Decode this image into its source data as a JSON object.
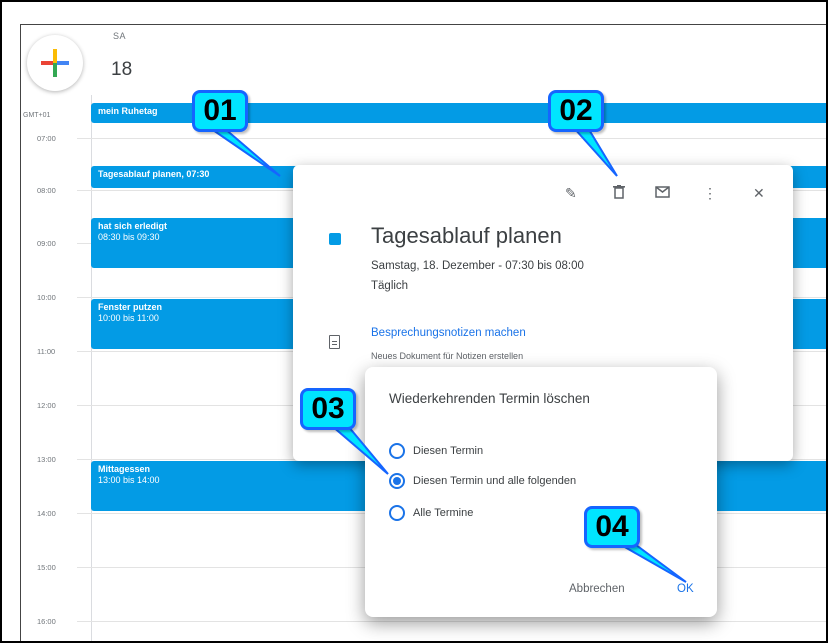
{
  "header": {
    "day_name": "SA",
    "day_number": "18",
    "timezone": "GMT+01"
  },
  "times": [
    "07:00",
    "08:00",
    "09:00",
    "10:00",
    "11:00",
    "12:00",
    "13:00",
    "14:00",
    "15:00",
    "16:00"
  ],
  "events": {
    "allday": "mein Ruhetag",
    "e1": {
      "title": "Tagesablauf planen, 07:30"
    },
    "e2": {
      "title": "hat sich erledigt",
      "time": "08:30 bis 09:30"
    },
    "e3": {
      "title": "Fenster putzen",
      "time": "10:00 bis 11:00"
    },
    "e4": {
      "title": "Mittagessen",
      "time": "13:00 bis 14:00"
    }
  },
  "popup": {
    "title": "Tagesablauf planen",
    "when": "Samstag, 18. Dezember  -  07:30 bis 08:00",
    "recurrence": "Täglich",
    "notes_link": "Besprechungsnotizen machen",
    "notes_sub": "Neues Dokument für Notizen erstellen",
    "icons": [
      "pencil-icon",
      "trash-icon",
      "mail-icon",
      "more-vert-icon",
      "close-icon"
    ]
  },
  "dialog": {
    "title": "Wiederkehrenden Termin löschen",
    "options": [
      "Diesen Termin",
      "Diesen Termin und alle folgenden",
      "Alle Termine"
    ],
    "selected_index": 1,
    "cancel": "Abbrechen",
    "ok": "OK"
  },
  "callouts": [
    "01",
    "02",
    "03",
    "04"
  ],
  "colors": {
    "event": "#039be5",
    "accent": "#1a73e8",
    "callout_fill": "#00e5ff",
    "callout_border": "#1565ff"
  }
}
